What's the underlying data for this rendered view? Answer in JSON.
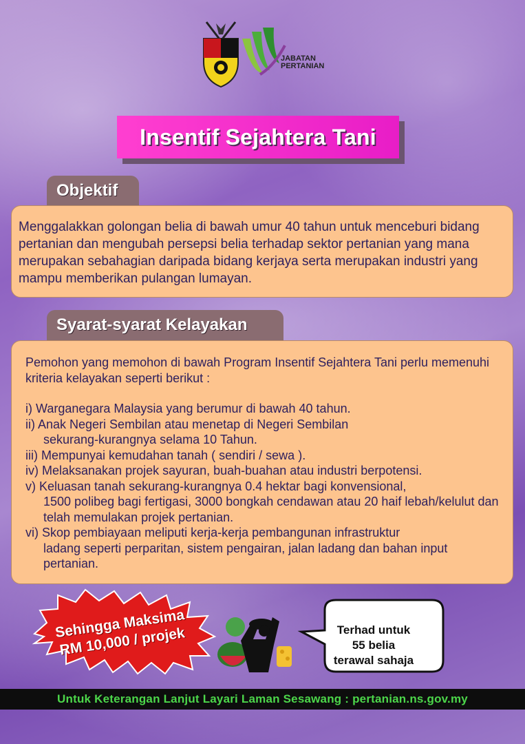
{
  "header": {
    "crest_icon": "negeri-sembilan-crest",
    "dept_logo_icon": "jabatan-pertanian-logo",
    "dept_line1": "JABATAN",
    "dept_line2": "PERTANIAN"
  },
  "title": "Insentif Sejahtera Tani",
  "objective": {
    "heading": "Objektif",
    "text": "Menggalakkan golongan belia di bawah umur 40 tahun untuk menceburi bidang pertanian dan mengubah persepsi belia terhadap sektor pertanian yang mana merupakan sebahagian daripada bidang kerjaya serta merupakan industri yang mampu memberikan pulangan lumayan."
  },
  "eligibility": {
    "heading": "Syarat-syarat Kelayakan",
    "intro": "Pemohon yang memohon di bawah Program Insentif Sejahtera Tani perlu memenuhi kriteria kelayakan seperti berikut :",
    "criteria": [
      {
        "line1": "i)  Warganegara Malaysia yang berumur di bawah 40 tahun.",
        "line2": ""
      },
      {
        "line1": "ii)  Anak Negeri Sembilan atau menetap di Negeri Sembilan",
        "line2": "sekurang-kurangnya selama 10 Tahun."
      },
      {
        "line1": "iii) Mempunyai kemudahan tanah ( sendiri / sewa ).",
        "line2": ""
      },
      {
        "line1": "iv) Melaksanakan projek sayuran, buah-buahan atau industri berpotensi.",
        "line2": ""
      },
      {
        "line1": "v)  Keluasan tanah sekurang-kurangnya 0.4 hektar bagi konvensional,",
        "line2": "1500 polibeg bagi fertigasi, 3000 bongkah cendawan atau 20 haif lebah/kelulut dan telah memulakan projek pertanian."
      },
      {
        "line1": "vi) Skop pembiayaan meliputi kerja-kerja pembangunan infrastruktur",
        "line2": "ladang seperti perparitan, sistem pengairan, jalan ladang dan bahan input pertanian."
      }
    ]
  },
  "promo": {
    "max_line1": "Sehingga Maksima",
    "max_line2": "RM 10,000 / projek",
    "art_icon": "farmer-with-produce-icon",
    "limit_line1": "Terhad untuk",
    "limit_line2": "55 belia",
    "limit_line3": "terawal sahaja"
  },
  "footer": {
    "text": "Untuk Keterangan Lanjut Layari Laman Sesawang : pertanian.ns.gov.my"
  },
  "colors": {
    "title_bg": "#ff3fd0",
    "panel_bg": "#fdc48e",
    "tab_bg": "#8a6c71",
    "burst_red": "#e01b1b",
    "footer_text": "#4cd64a"
  }
}
